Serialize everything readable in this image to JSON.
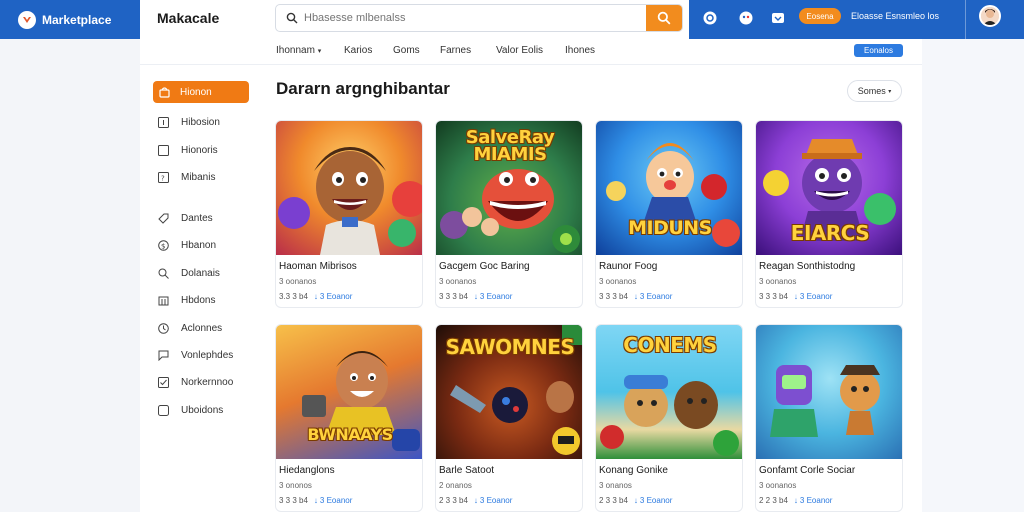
{
  "brand": {
    "name": "Marketplace"
  },
  "header": {
    "app_title": "Makacale",
    "search": {
      "placeholder": "Hbasesse mlbenalss"
    },
    "promo_label": "Eosena",
    "user_text": "Eloasse Esnsmleo los"
  },
  "subnav": {
    "items": [
      "Ihonnam",
      "Karios",
      "Goms",
      "Farnes",
      "Valor Eolis",
      "Ihones"
    ],
    "action_label": "Eonalos"
  },
  "sidebar": {
    "active": {
      "label": "Hionon",
      "icon": "bag-icon"
    },
    "items": [
      {
        "label": "Hibosion",
        "icon": "square-icon"
      },
      {
        "label": "Hionoris",
        "icon": "square-icon"
      },
      {
        "label": "Mibanis",
        "icon": "square-icon"
      },
      {
        "label": "Dantes",
        "icon": "tag-icon"
      },
      {
        "label": "Hbanon",
        "icon": "dollar-icon"
      },
      {
        "label": "Dolanais",
        "icon": "search-icon"
      },
      {
        "label": "Hbdons",
        "icon": "building-icon"
      },
      {
        "label": "Aclonnes",
        "icon": "clock-icon"
      },
      {
        "label": "Vonlephdes",
        "icon": "chat-icon"
      },
      {
        "label": "Norkernnoo",
        "icon": "check-icon"
      },
      {
        "label": "Uboidons",
        "icon": "square-icon"
      }
    ]
  },
  "main": {
    "heading": "Dararn argnghibantar",
    "sort_label": "Somes"
  },
  "cards": [
    {
      "name": "Haoman Mibrisos",
      "sub": "3 oonanos",
      "price": "3.3 3 b4",
      "link": "3 Eoanor",
      "art_title": "",
      "colors": [
        "#f6a23a",
        "#c23a4c"
      ]
    },
    {
      "name": "Gacgem Goc Baring",
      "sub": "3 oonanos",
      "price": "3 3 3 b4",
      "link": "3 Eoanor",
      "art_title": "SalveRay MIAMIS",
      "colors": [
        "#2e7d4a",
        "#123b20"
      ]
    },
    {
      "name": "Raunor Foog",
      "sub": "3 oonanos",
      "price": "3 3 3 b4",
      "link": "3 Eoanor",
      "art_title": "MIDUNS",
      "colors": [
        "#2f8ee6",
        "#0e3f9a"
      ]
    },
    {
      "name": "Reagan Sonthistodng",
      "sub": "3 oonanos",
      "price": "3 3 3 b4",
      "link": "3 Eoanor",
      "art_title": "EIARCS",
      "colors": [
        "#8c3fd6",
        "#3a0f7a"
      ]
    },
    {
      "name": "Hiedanglons",
      "sub": "3 ononos",
      "price": "3 3 3 b4",
      "link": "3 Eoanor",
      "art_title": "BWNAAYS",
      "colors": [
        "#f3a53a",
        "#3b55c6"
      ]
    },
    {
      "name": "Barle Satoot",
      "sub": "2 onanos",
      "price": "2 3 3 b4",
      "link": "3 Eoanor",
      "art_title": "SAWOMNES",
      "colors": [
        "#7a2a12",
        "#1d0d07"
      ]
    },
    {
      "name": "Konang Gonike",
      "sub": "3 onanos",
      "price": "2 3 3 b4",
      "link": "3 Eoanor",
      "art_title": "CONEMS",
      "colors": [
        "#4fc3e8",
        "#2f8f3a"
      ]
    },
    {
      "name": "Gonfamt Corle Sociar",
      "sub": "3 oonanos",
      "price": "2 2 3 b4",
      "link": "3 Eoanor",
      "art_title": "",
      "colors": [
        "#4bb5e0",
        "#2a6fb3"
      ]
    }
  ]
}
